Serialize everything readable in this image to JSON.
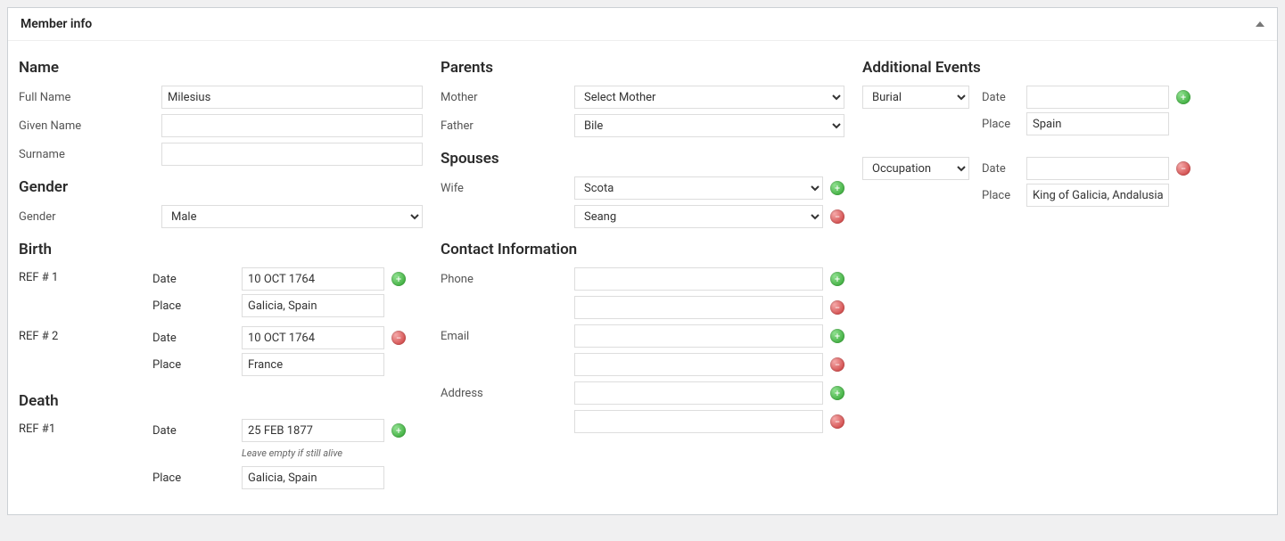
{
  "panel": {
    "title": "Member info"
  },
  "name": {
    "heading": "Name",
    "full_label": "Full Name",
    "full_value": "Milesius",
    "given_label": "Given Name",
    "given_value": "",
    "surname_label": "Surname",
    "surname_value": ""
  },
  "gender": {
    "heading": "Gender",
    "label": "Gender",
    "value": "Male"
  },
  "birth": {
    "heading": "Birth",
    "ref1": "REF # 1",
    "ref2": "REF # 2",
    "date_label": "Date",
    "place_label": "Place",
    "date1": "10 OCT 1764",
    "place1": "Galicia, Spain",
    "date2": "10 OCT 1764",
    "place2": "France"
  },
  "death": {
    "heading": "Death",
    "ref1": "REF #1",
    "date_label": "Date",
    "place_label": "Place",
    "date": "25 FEB 1877",
    "hint": "Leave empty if still alive",
    "place": "Galicia, Spain"
  },
  "parents": {
    "heading": "Parents",
    "mother_label": "Mother",
    "mother_value": "Select Mother",
    "father_label": "Father",
    "father_value": "Bile"
  },
  "spouses": {
    "heading": "Spouses",
    "wife_label": "Wife",
    "wife1": "Scota",
    "wife2": "Seang"
  },
  "contact": {
    "heading": "Contact Information",
    "phone_label": "Phone",
    "email_label": "Email",
    "address_label": "Address"
  },
  "events": {
    "heading": "Additional Events",
    "date_label": "Date",
    "place_label": "Place",
    "items": [
      {
        "type": "Burial",
        "date": "",
        "place": "Spain"
      },
      {
        "type": "Occupation",
        "date": "",
        "place": "King of Galicia, Andalusia"
      }
    ]
  },
  "glyphs": {
    "plus": "+",
    "minus": "−"
  }
}
